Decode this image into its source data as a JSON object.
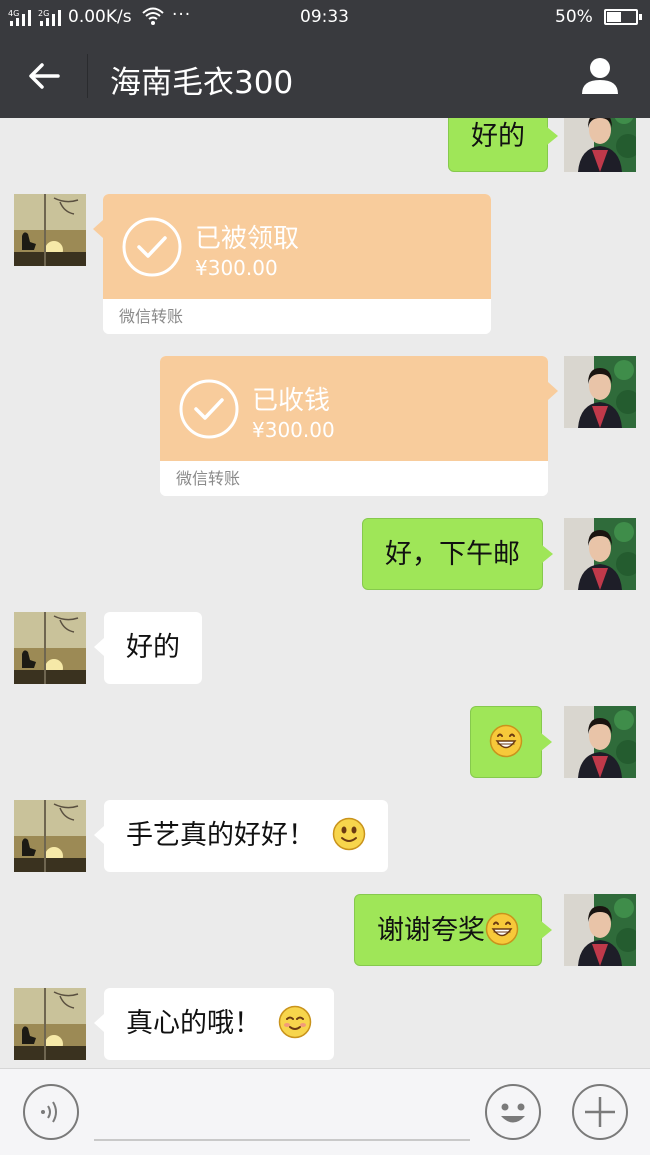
{
  "status_bar": {
    "signal_1": "4G",
    "signal_2": "2G",
    "network_speed": "0.00K/s",
    "more": "···",
    "time": "09:33",
    "battery": "50%"
  },
  "header": {
    "title": "海南毛衣300"
  },
  "messages": [
    {
      "side": "out",
      "type": "text",
      "text": "好的"
    },
    {
      "side": "in",
      "type": "transfer",
      "status": "已被领取",
      "amount": "¥300.00",
      "source": "微信转账"
    },
    {
      "side": "out",
      "type": "transfer",
      "status": "已收钱",
      "amount": "¥300.00",
      "source": "微信转账"
    },
    {
      "side": "out",
      "type": "text",
      "text": "好，下午邮"
    },
    {
      "side": "in",
      "type": "text",
      "text": "好的"
    },
    {
      "side": "out",
      "type": "emoji",
      "emoji": "grin-emoji"
    },
    {
      "side": "in",
      "type": "text",
      "text": "手艺真的好好！",
      "emoji": "smile-emoji"
    },
    {
      "side": "out",
      "type": "text",
      "text": "谢谢夸奖",
      "emoji": "grin-emoji"
    },
    {
      "side": "in",
      "type": "text",
      "text": "真心的哦！",
      "emoji": "blush-emoji"
    }
  ],
  "colors": {
    "bar": "#393a3e",
    "chat_bg": "#ebebeb",
    "outgoing_bubble": "#9fe658",
    "transfer_card": "#f8cc9c"
  },
  "input_bar": {
    "placeholder": ""
  }
}
